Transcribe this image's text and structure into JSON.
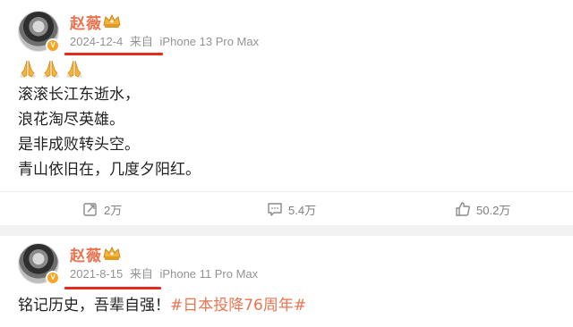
{
  "posts": [
    {
      "username": "赵薇",
      "date": "2024-12-4",
      "from_label": "来自",
      "device": "iPhone 13 Pro Max",
      "lines": [
        "滚滚长江东逝水，",
        "浪花淘尽英雄。",
        "是非成败转头空。",
        "青山依旧在，几度夕阳红。"
      ],
      "emoji_count": 3,
      "actions": {
        "repost": "2万",
        "comment": "5.4万",
        "like": "50.2万"
      }
    },
    {
      "username": "赵薇",
      "date": "2021-8-15",
      "from_label": "来自",
      "device": "iPhone 11 Pro Max",
      "text_plain": "铭记历史，吾辈自强！",
      "hashtag": "#日本投降76周年#"
    }
  ],
  "colors": {
    "username": "#eb7350",
    "meta": "#939393",
    "underline": "#e62b1e",
    "hashtag": "#eb7350",
    "action_text": "#808080",
    "verified_badge": "#f6a623"
  },
  "icons": {
    "verified": "v-badge-icon",
    "crown": "crown-icon",
    "pray": "folded-hands-icon",
    "repost": "repost-icon",
    "comment": "comment-icon",
    "like": "thumbs-up-icon"
  }
}
